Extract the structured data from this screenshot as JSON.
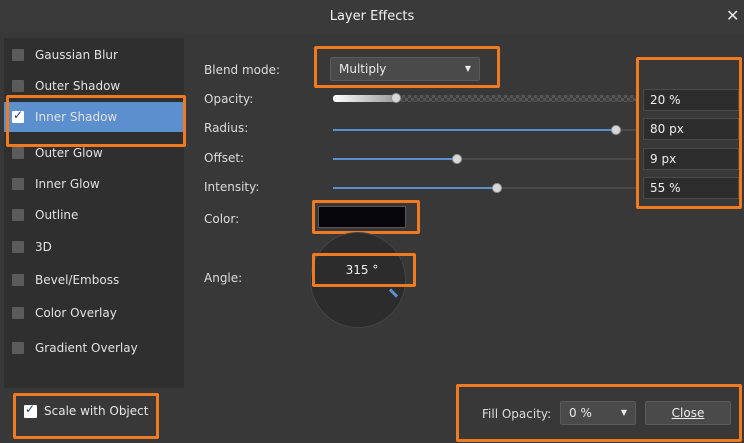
{
  "window": {
    "title": "Layer Effects",
    "close_glyph": "✕"
  },
  "sidebar": {
    "items": [
      {
        "label": "Gaussian Blur",
        "checked": false
      },
      {
        "label": "Outer Shadow",
        "checked": false
      },
      {
        "label": "Inner Shadow",
        "checked": true
      },
      {
        "label": "Outer Glow",
        "checked": false
      },
      {
        "label": "Inner Glow",
        "checked": false
      },
      {
        "label": "Outline",
        "checked": false
      },
      {
        "label": "3D",
        "checked": false
      },
      {
        "label": "Bevel/Emboss",
        "checked": false
      },
      {
        "label": "Color Overlay",
        "checked": false
      },
      {
        "label": "Gradient Overlay",
        "checked": false
      }
    ],
    "selected": "Inner Shadow"
  },
  "settings": {
    "blend_mode": {
      "label": "Blend mode:",
      "value": "Multiply"
    },
    "opacity": {
      "label": "Opacity:",
      "value": "20 %",
      "level": 0.2
    },
    "radius": {
      "label": "Radius:",
      "value": "80 px",
      "level": 0.95
    },
    "offset": {
      "label": "Offset:",
      "value": "9 px",
      "level": 0.45
    },
    "intensity": {
      "label": "Intensity:",
      "value": "55 %",
      "level": 0.55
    },
    "color": {
      "label": "Color:",
      "value": "#06060c"
    },
    "angle": {
      "label": "Angle:",
      "value": "315 °"
    }
  },
  "footer": {
    "scale_with_object": {
      "label": "Scale with Object",
      "checked": true
    },
    "fill_opacity": {
      "label": "Fill Opacity:",
      "value": "0 %"
    },
    "close_button": "Close"
  },
  "colors": {
    "accent": "#5b8fcd",
    "highlight": "#ee7a22",
    "background": "#383838"
  }
}
